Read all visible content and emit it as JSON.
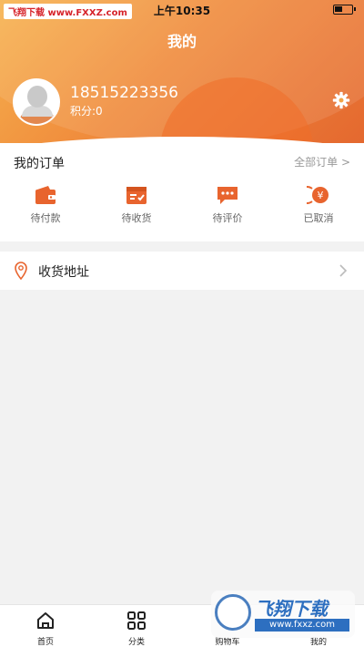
{
  "watermark_top": "飞翔下载 www.FXXZ.com",
  "status": {
    "time": "上午10:35"
  },
  "header": {
    "title": "我的"
  },
  "user": {
    "phone": "18515223356",
    "points": "积分:0"
  },
  "orders": {
    "title": "我的订单",
    "all_label": "全部订单 >",
    "items": [
      {
        "label": "待付款",
        "icon": "wallet-icon"
      },
      {
        "label": "待收货",
        "icon": "box-icon"
      },
      {
        "label": "待评价",
        "icon": "comment-icon"
      },
      {
        "label": "已取消",
        "icon": "yuan-cancel-icon"
      }
    ]
  },
  "address": {
    "label": "收货地址"
  },
  "tabbar": {
    "items": [
      {
        "label": "首页",
        "icon": "home-icon"
      },
      {
        "label": "分类",
        "icon": "grid-icon"
      },
      {
        "label": "购物车",
        "icon": "cart-icon"
      },
      {
        "label": "我的",
        "icon": "user-icon"
      }
    ]
  },
  "watermark_bottom": {
    "brand": "飞翔下载",
    "url": "www.fxxz.com"
  },
  "colors": {
    "accent": "#e8642e",
    "header_start": "#f6b24e",
    "header_end": "#e4682f"
  }
}
